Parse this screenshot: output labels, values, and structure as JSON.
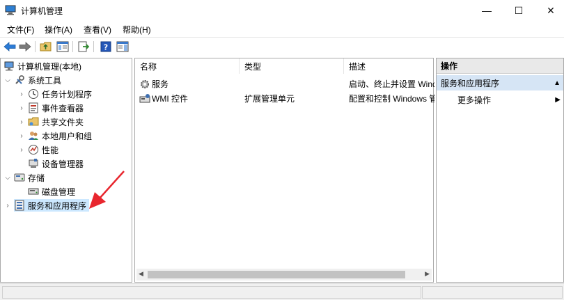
{
  "window": {
    "title": "计算机管理",
    "minimize_glyph": "—",
    "maximize_glyph": "☐",
    "close_glyph": "✕"
  },
  "menu": [
    "文件(F)",
    "操作(A)",
    "查看(V)",
    "帮助(H)"
  ],
  "toolbar": {
    "icons": [
      "back-arrow-icon",
      "forward-arrow-icon",
      "up-folder-icon",
      "show-hide-tree-icon",
      "export-list-icon",
      "help-icon",
      "show-hide-action-pane-icon"
    ]
  },
  "tree": {
    "root": "计算机管理(本地)",
    "system_tools": "系统工具",
    "task_scheduler": "任务计划程序",
    "event_viewer": "事件查看器",
    "shared_folders": "共享文件夹",
    "local_users": "本地用户和组",
    "performance": "性能",
    "device_manager": "设备管理器",
    "storage": "存储",
    "disk_management": "磁盘管理",
    "services_apps": "服务和应用程序"
  },
  "list": {
    "columns": [
      "名称",
      "类型",
      "描述"
    ],
    "rows": [
      {
        "name": "服务",
        "type": "",
        "desc": "启动、终止并设置 Windows 服务"
      },
      {
        "name": "WMI 控件",
        "type": "扩展管理单元",
        "desc": "配置和控制 Windows 管理规范"
      }
    ]
  },
  "actions": {
    "header": "操作",
    "section": "服务和应用程序",
    "more": "更多操作"
  },
  "colors": {
    "selection": "#cce8ff",
    "pane_header": "#e9e9e9",
    "section_bg": "#d6e5f5",
    "arrow": "#e8262e"
  }
}
